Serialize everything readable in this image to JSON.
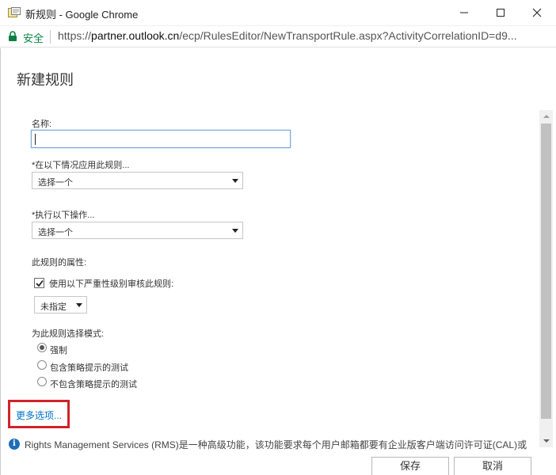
{
  "window": {
    "title": "新规则 - Google Chrome",
    "app_icon": "document-icon",
    "controls": [
      "minimize-icon",
      "maximize-icon",
      "close-icon"
    ]
  },
  "addressbar": {
    "secure_label": "安全",
    "url_scheme": "https://",
    "url_domain": "partner.outlook.cn",
    "url_path": "/ecp/RulesEditor/NewTransportRule.aspx?ActivityCorrelationID=d9..."
  },
  "dialog": {
    "title": "新建规则",
    "name_label": "名称:",
    "name_value": "",
    "condition_label": "*在以下情况应用此规则...",
    "condition_select": "选择一个",
    "action_label": "*执行以下操作...",
    "action_select": "选择一个",
    "properties_label": "此规则的属性:",
    "audit_checkbox_label": "使用以下严重性级别审核此规则:",
    "audit_checked": true,
    "severity_select": "未指定",
    "mode_label": "为此规则选择模式:",
    "modes": [
      {
        "label": "强制",
        "selected": true
      },
      {
        "label": "包含策略提示的测试",
        "selected": false
      },
      {
        "label": "不包含策略提示的测试",
        "selected": false
      }
    ],
    "more_options_link": "更多选项...",
    "rms_info": "Rights Management Services (RMS)是一种高级功能，该功能要求每个用户邮箱都要有企业版客户端访问许可证(CAL)或"
  },
  "footer": {
    "save_label": "保存",
    "cancel_label": "取消"
  },
  "colors": {
    "secure_green": "#0b8043",
    "link_blue": "#0072c6",
    "highlight_red": "#d0232a",
    "info_blue": "#1f6fb5"
  }
}
